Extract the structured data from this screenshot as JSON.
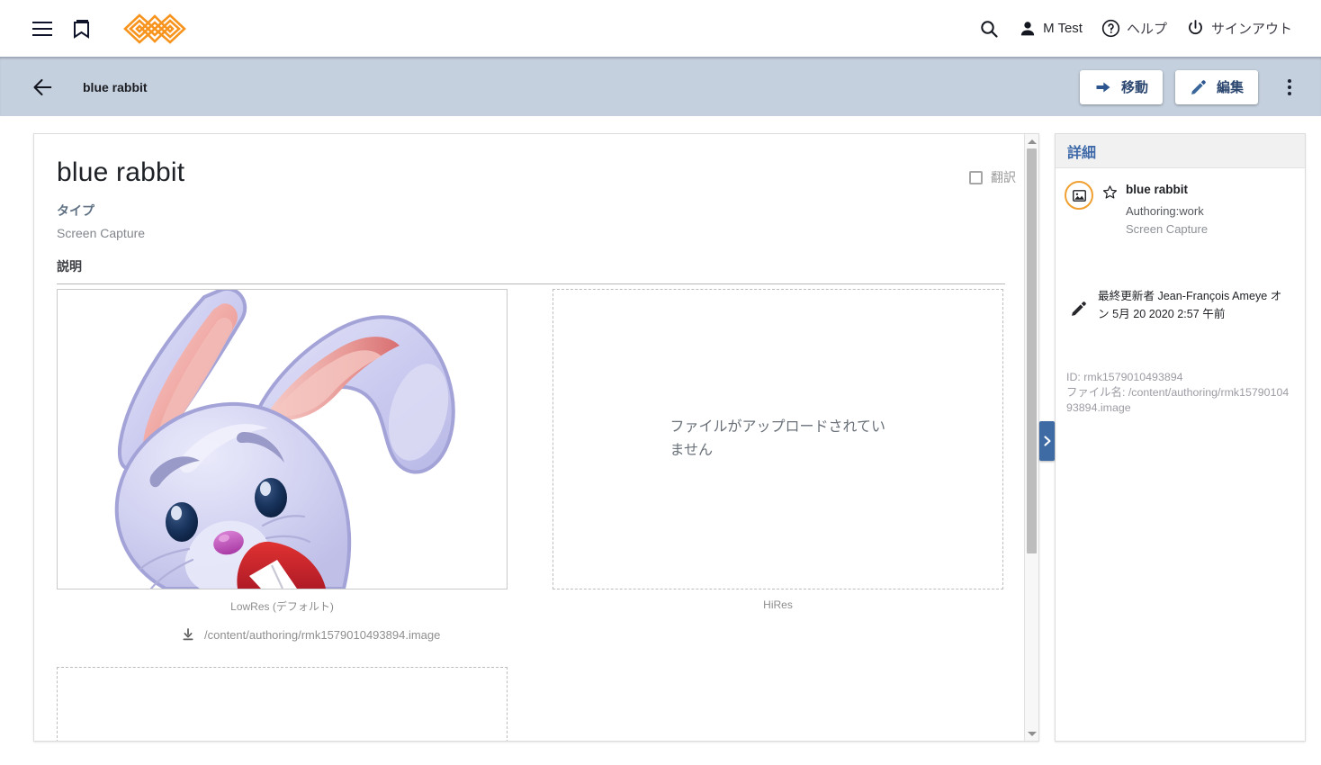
{
  "appbar": {
    "menu_icon": "hamburger-menu-icon",
    "bookmarks_icon": "collections-bookmark-icon",
    "logo_icon": "brand-logo-icon",
    "search_icon": "search-icon",
    "user_label": "M Test",
    "user_icon": "person-icon",
    "help_label": "ヘルプ",
    "help_icon": "help-circle-icon",
    "signout_label": "サインアウト",
    "signout_icon": "power-icon"
  },
  "toolbar": {
    "back_icon": "arrow-back-icon",
    "title": "blue rabbit",
    "move_label": "移動",
    "move_icon": "arrow-forward-icon",
    "edit_label": "編集",
    "edit_icon": "pencil-icon",
    "overflow_icon": "more-vert-icon"
  },
  "main": {
    "title": "blue rabbit",
    "translate_label": "翻訳",
    "type_label": "タイプ",
    "type_value": "Screen Capture",
    "description_label": "説明",
    "lowres_caption": "LowRes (デフォルト)",
    "hires_caption": "HiRes",
    "hires_empty_message": "ファイルがアップロードされていません",
    "file_link": "/content/authoring/rmk1579010493894.image",
    "download_icon": "download-icon",
    "scroll_up_icon": "scroll-up-arrow-icon",
    "scroll_down_icon": "scroll-down-arrow-icon",
    "collapse_icon": "chevron-right-icon"
  },
  "details": {
    "header": "詳細",
    "asset_icon": "image-thumbnail-icon",
    "star_icon": "star-outline-icon",
    "item_title": "blue rabbit",
    "item_path": "Authoring:work",
    "item_type": "Screen Capture",
    "modified_icon": "pencil-icon",
    "modified_text": "最終更新者 Jean-François Ameye オン 5月 20 2020 2:57 午前",
    "id_line": "ID: rmk1579010493894",
    "filename_line": "ファイル名: /content/authoring/rmk1579010493894.image"
  },
  "colors": {
    "toolbar_bg": "#c5d0de",
    "accent_blue": "#3d69a8",
    "brand_orange": "#f7941e",
    "handle_blue": "#3f6ba4"
  }
}
